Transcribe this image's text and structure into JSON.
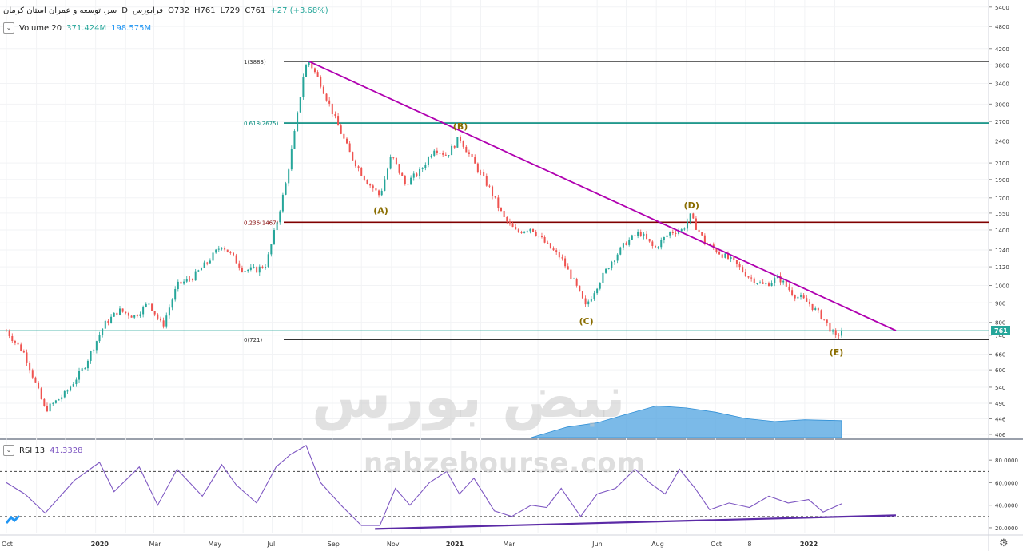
{
  "header": {
    "symbol": "سر. توسعه و عمران استان کرمان",
    "interval": "D",
    "exchange": "فرابورس",
    "ohlc": {
      "o": "O732",
      "h": "H761",
      "l": "L729",
      "c": "C761"
    },
    "change": "+27 (+3.68%)"
  },
  "volume_legend": {
    "label": "Volume 20",
    "v1": "371.424M",
    "v2": "198.575M"
  },
  "rsi_legend": {
    "label": "RSI 13",
    "value": "41.3328"
  },
  "watermark": {
    "site": "nabzebourse.com",
    "brand": "نبض بورس"
  },
  "last_price_tag": "761",
  "colors": {
    "up": "#26a69a",
    "down": "#ef5350",
    "trend": "#b000b0",
    "fib": "#800000",
    "fib618": "#00897b",
    "rsi": "#7e57c2",
    "volume_area": "#4fa3e0"
  },
  "chart_data": [
    {
      "type": "line",
      "title": "",
      "scale": "log",
      "ylim": [
        400,
        5500
      ],
      "x_ticks": [
        "Oct",
        "2020",
        "Mar",
        "May",
        "Jul",
        "Sep",
        "Nov",
        "2021",
        "Mar",
        "Jun",
        "Aug",
        "Oct",
        "8",
        "2022"
      ],
      "y_ticks": [
        5400,
        4800,
        4200,
        3800,
        3400,
        3000,
        2700,
        2400,
        2100,
        1900,
        1700,
        1550,
        1400,
        1240,
        1120,
        1000,
        900,
        800,
        740,
        660,
        600,
        540,
        490,
        446,
        406
      ],
      "fib_levels": [
        {
          "label": "1(3883)",
          "value": 3883
        },
        {
          "label": "0.618(2675)",
          "value": 2675
        },
        {
          "label": "0.236(1467)",
          "value": 1467
        },
        {
          "label": "0(721)",
          "value": 721
        }
      ],
      "wave_labels": [
        {
          "label": "(A)",
          "date": "2020-10-20",
          "price": 1720
        },
        {
          "label": "(B)",
          "date": "2021-01-10",
          "price": 2450
        },
        {
          "label": "(C)",
          "date": "2021-05-20",
          "price": 880
        },
        {
          "label": "(D)",
          "date": "2021-09-05",
          "price": 1520
        },
        {
          "label": "(E)",
          "date": "2022-02-02",
          "price": 729
        }
      ],
      "trendline": [
        {
          "date": "2020-08-08",
          "price": 3883
        },
        {
          "date": "2022-04-05",
          "price": 761
        }
      ],
      "series": [
        {
          "x": [
            "2019-10-01",
            "2019-10-20",
            "2019-11-10",
            "2019-12-01",
            "2019-12-20",
            "2020-01-10",
            "2020-01-25",
            "2020-02-10",
            "2020-02-25",
            "2020-03-10",
            "2020-03-25",
            "2020-04-10",
            "2020-04-25",
            "2020-05-10",
            "2020-05-20",
            "2020-06-01",
            "2020-06-15",
            "2020-06-25",
            "2020-07-05",
            "2020-07-15",
            "2020-07-25",
            "2020-08-03",
            "2020-08-08",
            "2020-08-20",
            "2020-09-05",
            "2020-09-20",
            "2020-10-05",
            "2020-10-20",
            "2020-11-01",
            "2020-11-15",
            "2020-12-01",
            "2020-12-15",
            "2020-12-28",
            "2021-01-10",
            "2021-01-25",
            "2021-02-10",
            "2021-02-25",
            "2021-03-10",
            "2021-03-25",
            "2021-04-10",
            "2021-04-25",
            "2021-05-10",
            "2021-05-20",
            "2021-06-01",
            "2021-06-15",
            "2021-07-01",
            "2021-07-15",
            "2021-07-30",
            "2021-08-15",
            "2021-08-28",
            "2021-09-05",
            "2021-09-20",
            "2021-10-05",
            "2021-10-20",
            "2021-11-05",
            "2021-11-20",
            "2021-12-05",
            "2021-12-20",
            "2022-01-05",
            "2022-01-20",
            "2022-02-02",
            "2022-02-08"
          ],
          "values": [
            760,
            660,
            470,
            520,
            610,
            790,
            860,
            830,
            900,
            780,
            1000,
            1050,
            1150,
            1280,
            1200,
            1100,
            1100,
            1140,
            1440,
            1850,
            2600,
            3700,
            3883,
            3400,
            2700,
            2200,
            1900,
            1720,
            2200,
            1850,
            2000,
            2300,
            2200,
            2450,
            2100,
            1800,
            1500,
            1380,
            1420,
            1280,
            1180,
            1000,
            880,
            1000,
            1150,
            1300,
            1380,
            1250,
            1380,
            1400,
            1520,
            1300,
            1220,
            1150,
            1050,
            1000,
            1050,
            950,
            900,
            820,
            729,
            761
          ]
        }
      ]
    },
    {
      "type": "area",
      "title": "Volume 20",
      "series": [
        {
          "x": [
            "2021-03-25",
            "2021-05-01",
            "2021-06-01",
            "2021-07-01",
            "2021-08-01",
            "2021-09-01",
            "2021-10-01",
            "2021-11-01",
            "2021-12-01",
            "2022-01-01",
            "2022-02-08"
          ],
          "values": [
            0.0,
            0.25,
            0.35,
            0.55,
            0.75,
            0.7,
            0.6,
            0.45,
            0.38,
            0.42,
            0.4
          ]
        }
      ]
    },
    {
      "type": "line",
      "title": "RSI 13",
      "ylim": [
        15,
        95
      ],
      "y_ticks": [
        "80.0000",
        "60.0000",
        "40.0000",
        "20.0000"
      ],
      "bands": [
        70,
        30
      ],
      "trendline": [
        {
          "date": "2020-10-15",
          "value": 19
        },
        {
          "date": "2022-04-05",
          "value": 31
        }
      ],
      "series": [
        {
          "x": [
            "2019-10-01",
            "2019-10-20",
            "2019-11-10",
            "2019-12-10",
            "2020-01-05",
            "2020-01-20",
            "2020-02-15",
            "2020-03-05",
            "2020-03-25",
            "2020-04-20",
            "2020-05-10",
            "2020-05-25",
            "2020-06-15",
            "2020-07-05",
            "2020-07-20",
            "2020-08-05",
            "2020-08-20",
            "2020-09-10",
            "2020-10-01",
            "2020-10-20",
            "2020-11-05",
            "2020-11-20",
            "2020-12-10",
            "2020-12-28",
            "2021-01-10",
            "2021-01-25",
            "2021-02-15",
            "2021-03-05",
            "2021-03-25",
            "2021-04-10",
            "2021-04-25",
            "2021-05-15",
            "2021-06-01",
            "2021-06-20",
            "2021-07-10",
            "2021-07-25",
            "2021-08-10",
            "2021-08-25",
            "2021-09-10",
            "2021-09-25",
            "2021-10-15",
            "2021-11-05",
            "2021-11-25",
            "2021-12-15",
            "2022-01-05",
            "2022-01-20",
            "2022-02-08"
          ],
          "values": [
            60,
            50,
            33,
            62,
            78,
            52,
            74,
            40,
            72,
            48,
            76,
            58,
            42,
            74,
            85,
            93,
            60,
            40,
            22,
            22,
            55,
            40,
            60,
            70,
            50,
            64,
            35,
            30,
            40,
            38,
            55,
            30,
            50,
            55,
            72,
            60,
            50,
            72,
            55,
            36,
            42,
            38,
            48,
            42,
            45,
            34,
            41.3
          ]
        }
      ]
    }
  ]
}
